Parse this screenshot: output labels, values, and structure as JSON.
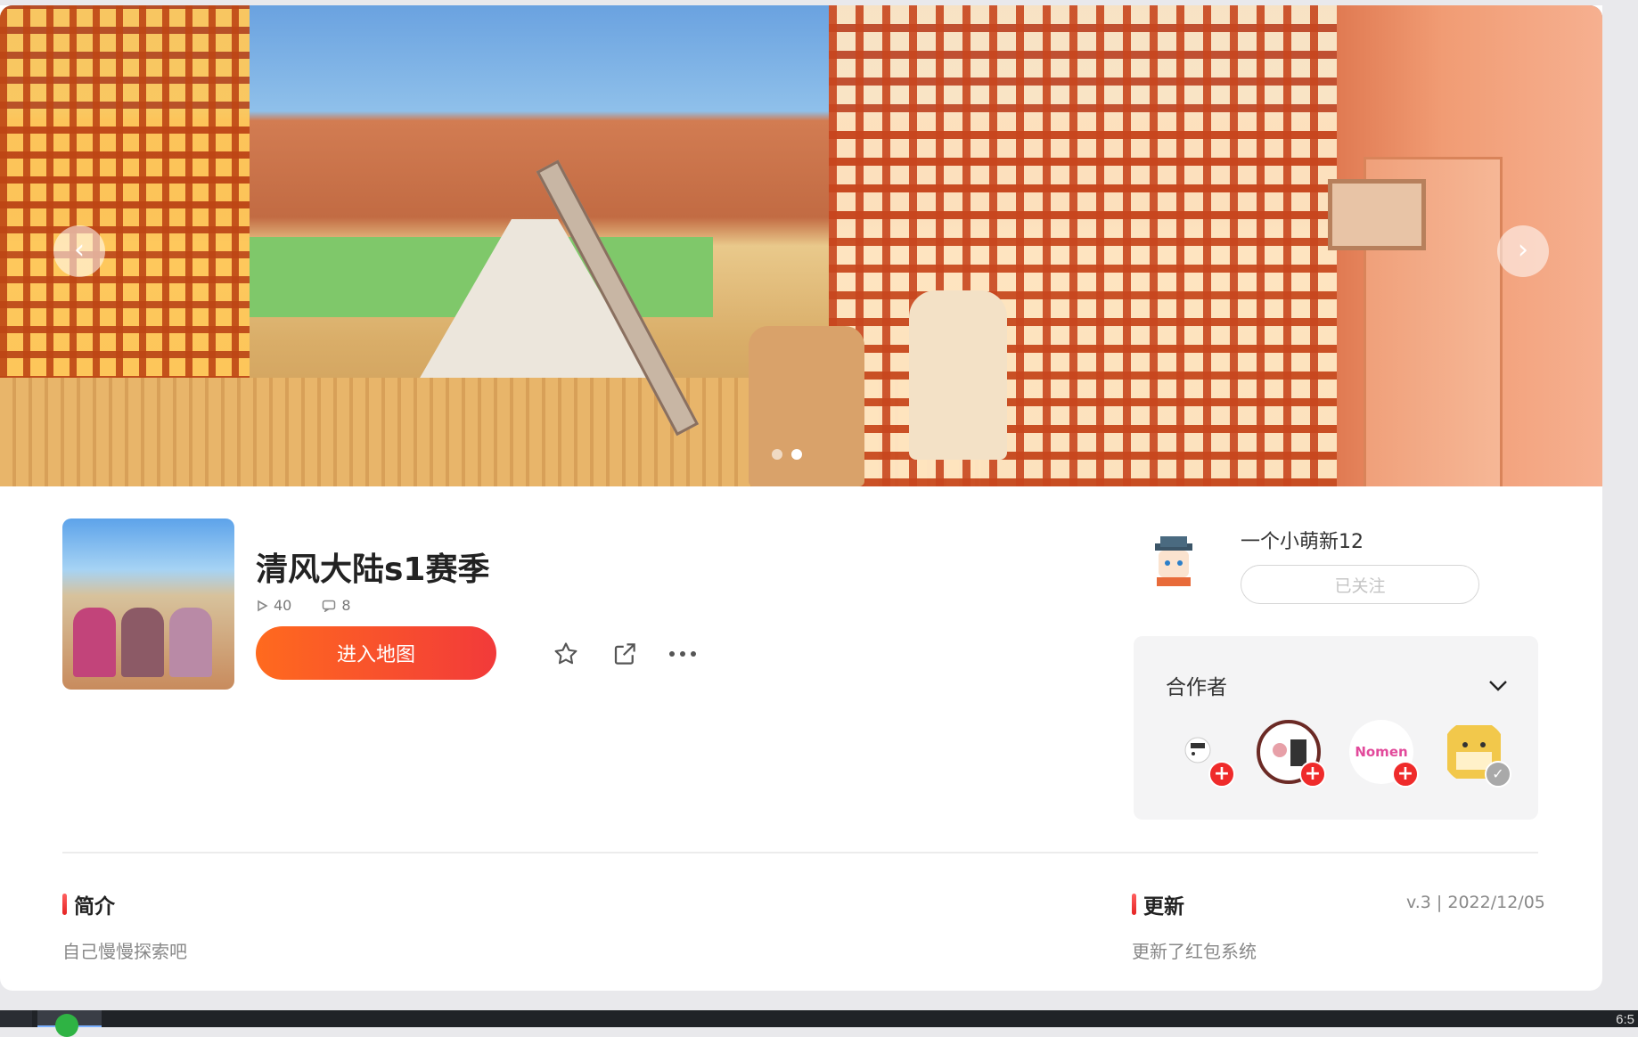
{
  "banner": {
    "prev_icon": "chevron-left-icon",
    "next_icon": "chevron-right-icon",
    "slides_count": 2,
    "active_slide": 2
  },
  "map": {
    "title": "清风大陆s1赛季",
    "plays": "40",
    "comments": "8",
    "enter_label": "进入地图"
  },
  "actions": {
    "favorite_icon": "star-icon",
    "share_icon": "share-icon",
    "more_icon": "more-icon"
  },
  "author": {
    "name": "一个小萌新12",
    "follow_label": "已关注"
  },
  "collaborators": {
    "title": "合作者",
    "items": [
      {
        "label": "collaborator-1",
        "status": "add"
      },
      {
        "label": "collaborator-2",
        "status": "add"
      },
      {
        "label": "collaborator-3",
        "status": "add",
        "logo_text": "Nomen"
      },
      {
        "label": "collaborator-4",
        "status": "followed"
      }
    ]
  },
  "intro": {
    "title": "简介",
    "text": "自己慢慢探索吧"
  },
  "update": {
    "title": "更新",
    "version": "v.3 | 2022/12/05",
    "text": "更新了红包系统"
  },
  "taskbar": {
    "clock": "6:5"
  },
  "colors": {
    "accent_start": "#ff6a1e",
    "accent_end": "#f23a3a",
    "badge_red": "#ef2b2b"
  }
}
